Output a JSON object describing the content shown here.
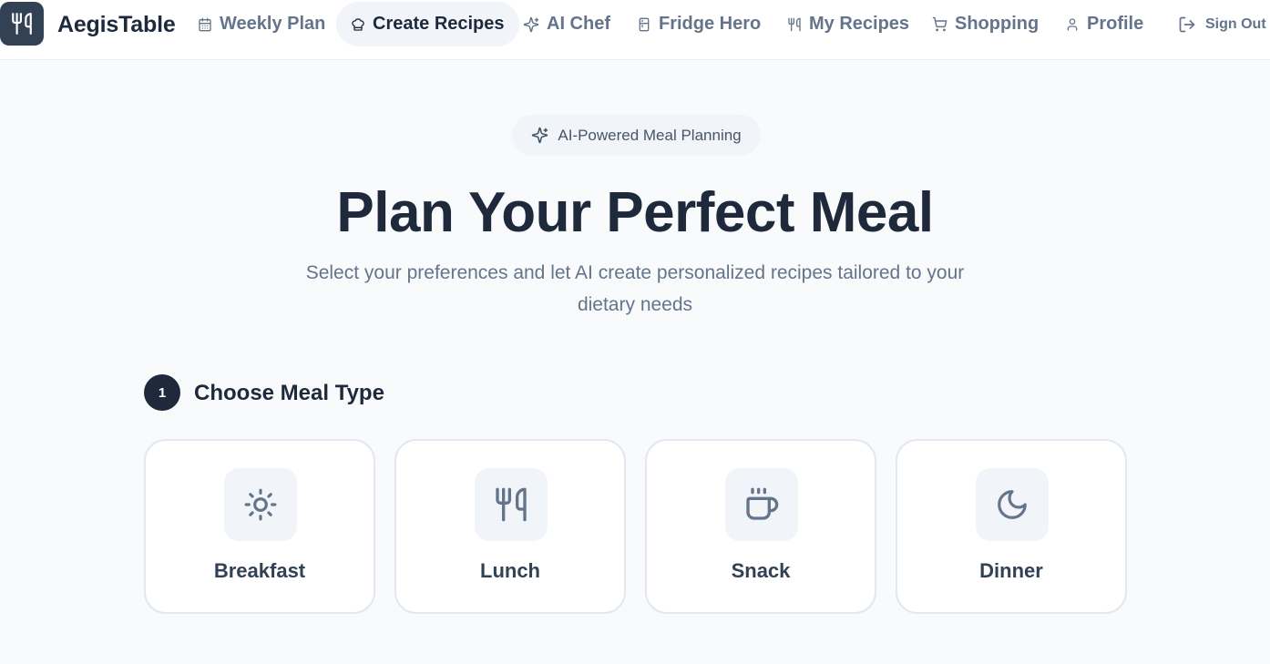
{
  "app": {
    "brand_name": "AegisTable"
  },
  "nav": {
    "items": [
      {
        "label": "Weekly Plan",
        "icon": "calendar-icon",
        "active": false
      },
      {
        "label": "Create Recipes",
        "icon": "chef-hat-icon",
        "active": true
      },
      {
        "label": "AI Chef",
        "icon": "sparkles-icon",
        "active": false
      },
      {
        "label": "Fridge Hero",
        "icon": "fridge-icon",
        "active": false
      },
      {
        "label": "My Recipes",
        "icon": "utensils-icon",
        "active": false
      },
      {
        "label": "Shopping",
        "icon": "cart-icon",
        "active": false
      },
      {
        "label": "Profile",
        "icon": "user-icon",
        "active": false
      }
    ],
    "sign_out_label": "Sign Out"
  },
  "hero": {
    "badge": "AI-Powered Meal Planning",
    "title": "Plan Your Perfect Meal",
    "subtitle": "Select your preferences and let AI create personalized recipes tailored to your dietary needs"
  },
  "step1": {
    "number": "1",
    "title": "Choose Meal Type",
    "options": [
      {
        "label": "Breakfast",
        "icon": "sun-icon"
      },
      {
        "label": "Lunch",
        "icon": "utensils-icon"
      },
      {
        "label": "Snack",
        "icon": "coffee-icon"
      },
      {
        "label": "Dinner",
        "icon": "moon-icon"
      }
    ]
  },
  "colors": {
    "accent": "#1e293b",
    "muted": "#64748b",
    "background": "#f8fafc",
    "card_border": "#e2e8f0"
  }
}
